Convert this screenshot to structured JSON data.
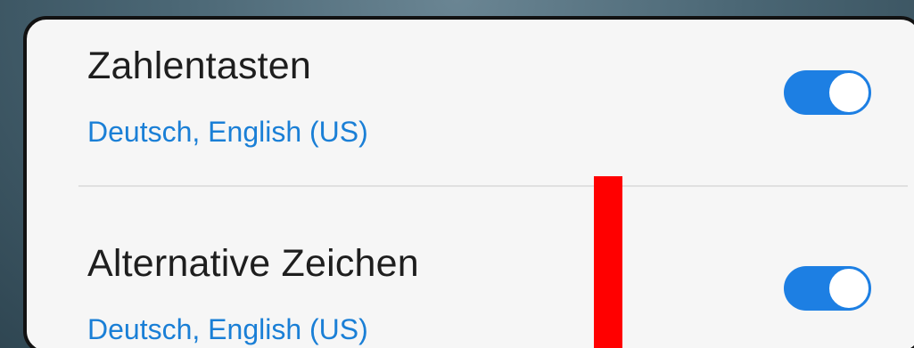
{
  "settings": {
    "items": [
      {
        "title": "Zahlentasten",
        "subtitle": "Deutsch, English (US)",
        "enabled": true
      },
      {
        "title": "Alternative Zeichen",
        "subtitle": "Deutsch, English (US)",
        "enabled": true
      }
    ]
  },
  "colors": {
    "accent": "#1d7fe3",
    "subtitle_text": "#1a7fd6",
    "panel_background": "#f6f6f6",
    "annotation_marker": "#ff0000"
  },
  "icons": {
    "toggle": "toggle-switch-on-icon"
  }
}
